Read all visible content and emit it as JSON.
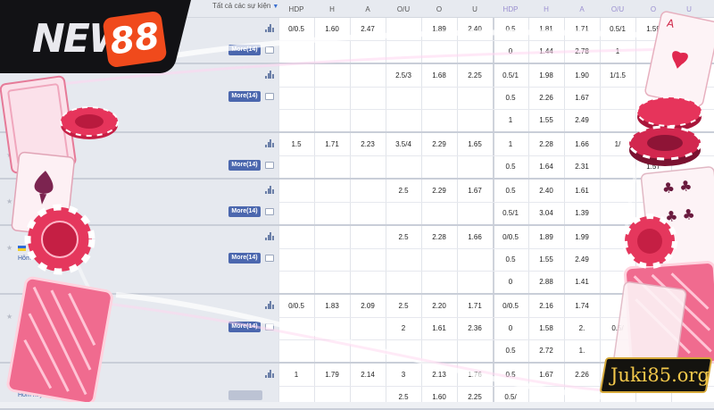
{
  "header": {
    "filter_label": "Tất cả các sự kiện",
    "columns": [
      "HDP",
      "H",
      "A",
      "O/U",
      "O",
      "U",
      "HDP",
      "H",
      "A",
      "O/U",
      "O",
      "U"
    ]
  },
  "brand": {
    "logo_text": "NEW",
    "logo_number": "88",
    "watermark": "Juki85.org"
  },
  "matches": [
    {
      "team": "",
      "date": "",
      "more": "More(14)",
      "rows": [
        [
          "0/0.5",
          "1.60",
          "2.47",
          "",
          "1.89",
          "2.40",
          "0.5",
          "1.81",
          "1.71",
          "0.5/1",
          "1.59",
          ""
        ],
        [
          "",
          "",
          "",
          "",
          "",
          "",
          "0",
          "1.44",
          "2.78",
          "1",
          "",
          ""
        ]
      ]
    },
    {
      "team": "",
      "date": "",
      "more": "More(14)",
      "rows": [
        [
          "",
          "",
          "",
          "2.5/3",
          "1.68",
          "2.25",
          "0.5/1",
          "1.98",
          "1.90",
          "1/1.5",
          "",
          ""
        ],
        [
          "",
          "",
          "",
          "",
          "",
          "",
          "0.5",
          "2.26",
          "1.67",
          "",
          "",
          ""
        ],
        [
          "",
          "",
          "",
          "",
          "",
          "",
          "1",
          "1.55",
          "2.49",
          "",
          "",
          ""
        ]
      ]
    },
    {
      "team": "",
      "date": "Hôm",
      "more": "More(14)",
      "rows": [
        [
          "1.5",
          "1.71",
          "2.23",
          "3.5/4",
          "2.29",
          "1.65",
          "1",
          "2.28",
          "1.66",
          "1/",
          "",
          ""
        ],
        [
          "",
          "",
          "",
          "",
          "",
          "",
          "0.5",
          "1.64",
          "2.31",
          "",
          "1.57",
          ""
        ]
      ]
    },
    {
      "team": "",
      "date": "",
      "more": "More(14)",
      "rows": [
        [
          "",
          "",
          "",
          "2.5",
          "2.29",
          "1.67",
          "0.5",
          "2.40",
          "1.61",
          "",
          "",
          ""
        ],
        [
          "",
          "",
          "",
          "",
          "",
          "",
          "0.5/1",
          "3.04",
          "1.39",
          "",
          "",
          ""
        ]
      ]
    },
    {
      "team": "Ukra",
      "date": "Hôm",
      "more": "More(14)",
      "rows": [
        [
          "",
          "",
          "",
          "2.5",
          "2.28",
          "1.66",
          "0/0.5",
          "1.89",
          "1.99",
          "",
          "",
          ""
        ],
        [
          "",
          "",
          "",
          "",
          "",
          "",
          "0.5",
          "1.55",
          "2.49",
          "",
          "",
          ""
        ],
        [
          "",
          "",
          "",
          "",
          "",
          "",
          "0",
          "2.88",
          "1.41",
          "",
          "",
          ""
        ]
      ]
    },
    {
      "team": "",
      "date": "",
      "more": "More(14)",
      "rows": [
        [
          "0/0.5",
          "1.83",
          "2.09",
          "2.5",
          "2.20",
          "1.71",
          "0/0.5",
          "2.16",
          "1.74",
          "",
          "",
          ""
        ],
        [
          "",
          "",
          "",
          "2",
          "1.61",
          "2.36",
          "0",
          "1.58",
          "2.",
          "0.5/",
          "",
          ""
        ],
        [
          "",
          "",
          "",
          "",
          "",
          "",
          "0.5",
          "2.72",
          "1.",
          "",
          "",
          ""
        ]
      ]
    },
    {
      "team": "",
      "date": "Hôm nay 07/",
      "more": "",
      "rows": [
        [
          "1",
          "1.79",
          "2.14",
          "3",
          "2.13",
          "1.76",
          "0.5",
          "1.67",
          "2.26",
          "",
          "",
          ""
        ],
        [
          "",
          "",
          "",
          "2.5",
          "1.60",
          "2.25",
          "0.5/",
          "",
          "",
          "",
          "",
          ""
        ]
      ]
    }
  ]
}
